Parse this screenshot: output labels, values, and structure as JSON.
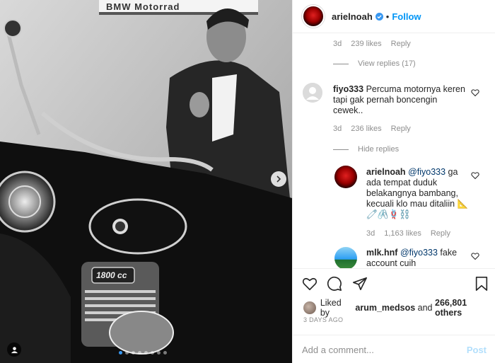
{
  "photo": {
    "sign_text": "BMW Motorrad",
    "badge_text": "1800 cc"
  },
  "header": {
    "username": "arielnoah",
    "separator": "•",
    "follow_label": "Follow"
  },
  "comments": {
    "top_meta": {
      "time": "3d",
      "likes": "239 likes",
      "reply": "Reply"
    },
    "view_replies": "View replies (17)",
    "c1": {
      "username": "fiyo333",
      "text": "Percuma motornya keren tapi gak pernah boncengin cewek..",
      "time": "3d",
      "likes": "236 likes",
      "reply": "Reply"
    },
    "hide_replies": "Hide replies",
    "r1": {
      "username": "arielnoah",
      "mention": "@fiyo333",
      "text": "ga ada tempat duduk belakangnya bambang, kecuali klo mau ditaliin",
      "emoji": "📐🧷🖇️🪢⛓️",
      "time": "3d",
      "likes": "1,163 likes",
      "reply": "Reply"
    },
    "r2": {
      "username": "mlk.hnf",
      "mention": "@fiyo333",
      "text": "fake account cuih"
    }
  },
  "actions": {
    "liked_prefix": "Liked by",
    "liked_user": "arum_medsos",
    "liked_and": "and",
    "liked_count": "266,801 others",
    "date": "3 DAYS AGO",
    "comment_placeholder": "Add a comment...",
    "post_label": "Post"
  },
  "colors": {
    "accent": "#0095f6",
    "muted": "#8e8e8e",
    "post_disabled": "#b2dffc"
  }
}
